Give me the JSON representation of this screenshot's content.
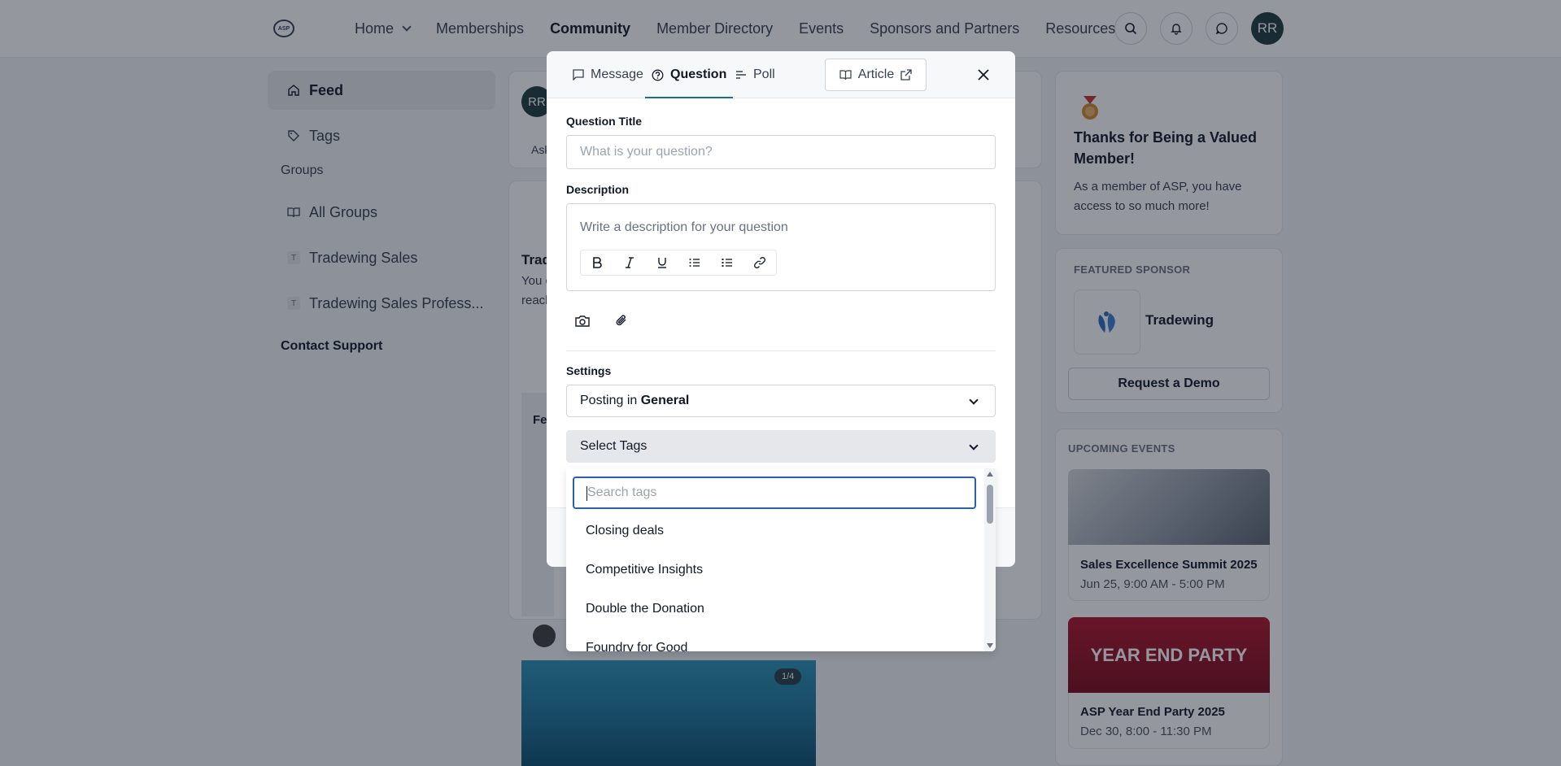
{
  "nav": {
    "logo_text": "ASP",
    "links": [
      "Home",
      "Memberships",
      "Community",
      "Member Directory",
      "Events",
      "Sponsors and Partners",
      "Resources"
    ],
    "active": "Community",
    "avatar": "RR"
  },
  "sidebar": {
    "items": [
      {
        "label": "Feed"
      },
      {
        "label": "Tags"
      }
    ],
    "groups_heading": "Groups",
    "groups": [
      {
        "label": "All Groups"
      },
      {
        "label": "Tradewing Sales",
        "badge": "T"
      },
      {
        "label": "Tradewing Sales Profess...",
        "badge": "T"
      }
    ],
    "contact": "Contact Support"
  },
  "feed": {
    "composer_avatar": "RR",
    "ask_text": "Ask",
    "post_title": "Trad",
    "post_text_1": "You c",
    "post_text_2": "reach",
    "fe_text": "Fe",
    "image_counter": "1/4"
  },
  "right": {
    "thanks_title": "Thanks for Being a Valued Member!",
    "thanks_text": "As a member of ASP, you have access to so much more!",
    "featured_label": "FEATURED SPONSOR",
    "sponsor_name": "Tradewing",
    "demo_button": "Request a Demo",
    "events_label": "UPCOMING EVENTS",
    "events": [
      {
        "title": "Sales Excellence Summit 2025",
        "date": "Jun 25, 9:00 AM - 5:00 PM"
      },
      {
        "title": "ASP Year End Party 2025",
        "date": "Dec 30, 8:00 - 11:30 PM",
        "image_text": "YEAR END PARTY"
      }
    ]
  },
  "modal": {
    "tabs": [
      {
        "label": "Message",
        "icon": "message-icon"
      },
      {
        "label": "Question",
        "icon": "question-icon"
      },
      {
        "label": "Poll",
        "icon": "poll-icon"
      }
    ],
    "active_tab": "Question",
    "article_label": "Article",
    "question_title_label": "Question Title",
    "question_title_placeholder": "What is your question?",
    "description_label": "Description",
    "description_placeholder": "Write a description for your question",
    "settings_label": "Settings",
    "posting_prefix": "Posting in",
    "posting_group": "General",
    "tags_label": "Select Tags"
  },
  "tag_dropdown": {
    "search_placeholder": "Search tags",
    "options": [
      "Closing deals",
      "Competitive Insights",
      "Double the Donation",
      "Foundry for Good"
    ]
  }
}
